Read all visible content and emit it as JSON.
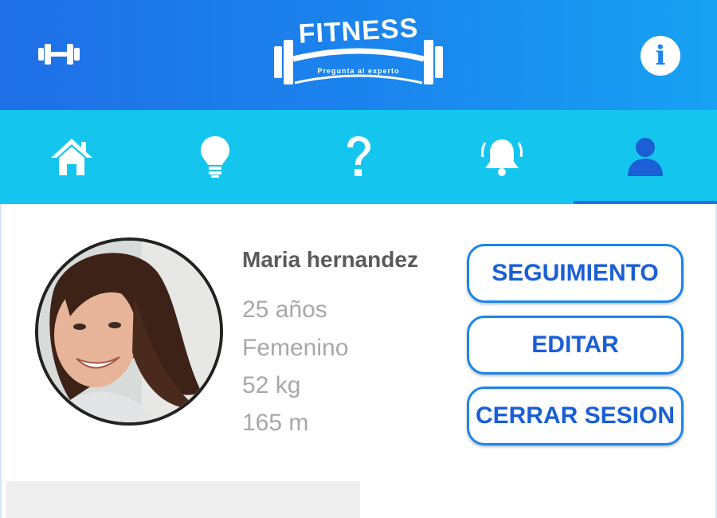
{
  "header": {
    "logo_text": "FITNESS",
    "logo_tagline": "Pregunta al experto",
    "menu_icon": "dumbbell-icon",
    "info_icon": "info-icon",
    "info_glyph": "i",
    "gradient_colors": [
      "#1f6fe6",
      "#17a2f2"
    ]
  },
  "tabs": [
    {
      "name": "home",
      "icon": "home-icon",
      "active": false
    },
    {
      "name": "tips",
      "icon": "lightbulb-icon",
      "active": false
    },
    {
      "name": "questions",
      "icon": "question-icon",
      "active": false
    },
    {
      "name": "notifications",
      "icon": "bell-icon",
      "active": false
    },
    {
      "name": "profile",
      "icon": "user-icon",
      "active": true
    }
  ],
  "tab_bar_color": "#14c5ee",
  "accent_color": "#1a86ee",
  "profile": {
    "name": "Maria hernandez",
    "age": "25 años",
    "gender": "Femenino",
    "weight": "52 kg",
    "height": "165 m"
  },
  "actions": {
    "tracking_label": "SEGUIMIENTO",
    "edit_label": "EDITAR",
    "logout_label": "CERRAR SESION"
  }
}
